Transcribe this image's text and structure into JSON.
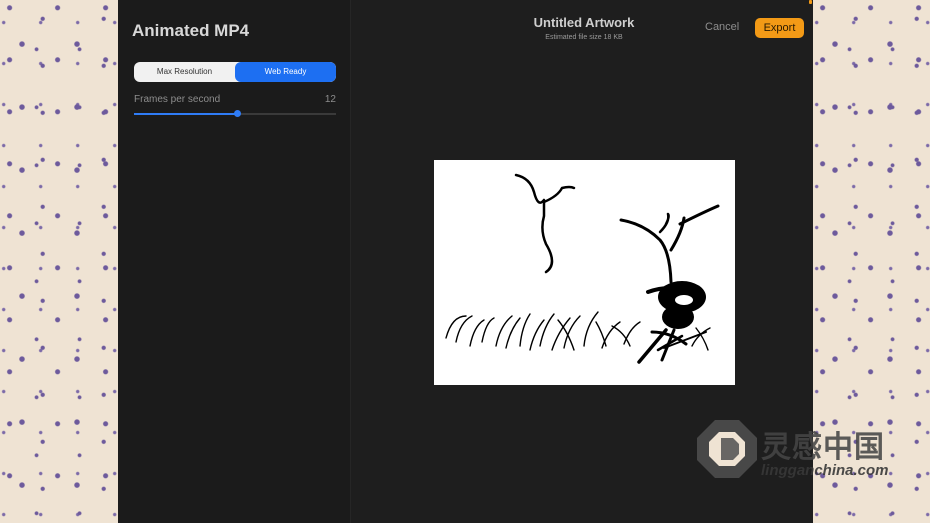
{
  "panel": {
    "title": "Animated MP4",
    "quality_options": [
      "Max Resolution",
      "Web Ready"
    ],
    "selected_option": "Web Ready",
    "fps_label": "Frames per second",
    "fps_value": "12",
    "fps_slider_fraction": 0.51
  },
  "header": {
    "title": "Untitled Artwork",
    "subtitle": "Estimated file size 18 KB",
    "cancel_label": "Cancel",
    "export_label": "Export"
  },
  "colors": {
    "accent": "#1d6ff2",
    "export": "#f39a16",
    "background": "#1e1e1e"
  },
  "watermark": {
    "brand": "灵感中国",
    "url": "lingganchina.com"
  }
}
